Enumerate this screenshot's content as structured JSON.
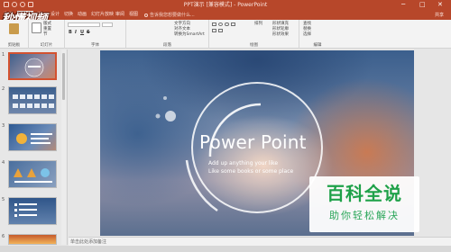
{
  "window": {
    "title": "PPT演示 [兼容模式] - PowerPoint",
    "minimize": "─",
    "maximize": "□",
    "close": "✕"
  },
  "tabs": [
    {
      "label": "文件",
      "active": false
    },
    {
      "label": "开始",
      "active": true
    },
    {
      "label": "插入",
      "active": false
    },
    {
      "label": "设计",
      "active": false
    },
    {
      "label": "切换",
      "active": false
    },
    {
      "label": "动画",
      "active": false
    },
    {
      "label": "幻灯片放映",
      "active": false
    },
    {
      "label": "审阅",
      "active": false
    },
    {
      "label": "视图",
      "active": false
    }
  ],
  "tell_me": "告诉我您想要做什么...",
  "share": "共享",
  "logo": "秒懂视频",
  "ribbon": {
    "clipboard": {
      "label": "剪贴板",
      "paste": "粘贴"
    },
    "slides": {
      "label": "幻灯片",
      "new_slide": "新建幻灯片",
      "layout": "版式",
      "reset": "重置",
      "section": "节"
    },
    "font": {
      "label": "字体",
      "bold": "B",
      "italic": "I",
      "underline": "U",
      "strike": "S"
    },
    "paragraph": {
      "label": "段落",
      "text_direction": "文字方向",
      "align_text": "对齐文本",
      "smartart": "转换为SmartArt"
    },
    "drawing": {
      "label": "绘图",
      "arrange": "排列",
      "quick_styles": "快速样式",
      "shape_fill": "形状填充",
      "shape_outline": "形状轮廓",
      "shape_effects": "形状效果"
    },
    "editing": {
      "label": "编辑",
      "find": "查找",
      "replace": "替换",
      "select": "选择"
    }
  },
  "slides": [
    {
      "number": "1",
      "selected": true
    },
    {
      "number": "2",
      "selected": false
    },
    {
      "number": "3",
      "selected": false
    },
    {
      "number": "4",
      "selected": false
    },
    {
      "number": "5",
      "selected": false
    },
    {
      "number": "6",
      "selected": false
    }
  ],
  "slide": {
    "title": "Power Point",
    "line1": "Add up anything your like",
    "line2": "Like some books or some place"
  },
  "watermark": {
    "big": "百科全说",
    "small": "助你轻松解决"
  },
  "notes_placeholder": "单击此处添加备注",
  "colors": {
    "accent": "#b7472a",
    "selected_border": "#d35230",
    "watermark_green": "#1fa149"
  }
}
